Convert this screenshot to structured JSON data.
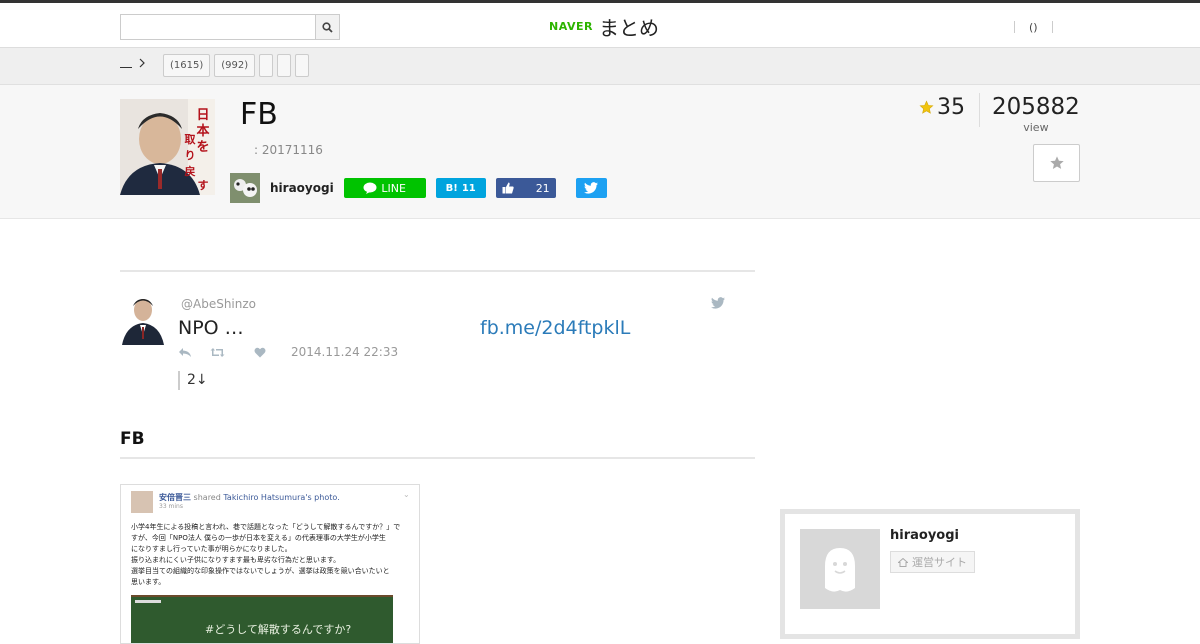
{
  "header": {
    "search": {
      "placeholder": "",
      "value": ""
    },
    "logo": {
      "brand": "NAVER",
      "product": "まとめ"
    },
    "user_nav": {
      "link_label": "()"
    }
  },
  "category_bar": {
    "tags": [
      "(1615)",
      "(992)",
      "",
      "",
      ""
    ]
  },
  "matome": {
    "title": "FB",
    "date": ": 20171116",
    "author": "hiraoyogi",
    "share": {
      "line_label": "LINE",
      "hatena_label": "B!",
      "hatena_count": "11",
      "facebook_count": "21"
    },
    "favorites": "35",
    "views": "205882",
    "views_label": "view"
  },
  "tweet": {
    "handle": "@AbeShinzo",
    "text": "NPO …",
    "link": "fb.me/2d4ftpklL",
    "timestamp": "2014.11.24 22:33",
    "quote": "2↓"
  },
  "section": {
    "heading": "FB"
  },
  "embedded_post": {
    "author": "安倍晋三",
    "shared_text": "shared",
    "source": "Takichiro Hatsumura's photo.",
    "time": "33 mins",
    "lines": [
      "小学4年生による投稿と言われ、巷で話題となった「どうして解散するんですか？」で",
      "すが、今回「NPO法人 僕らの一歩が日本を変える」の代表理事の大学生が小学生",
      "になりすまし行っていた事が明らかになりました。",
      "振り込まれにくい子供になりすます最も卑劣な行為だと思います。",
      "選挙目当ての組織的な印象操作ではないでしょうが、選挙は政策を競い合いたいと",
      "思います。"
    ],
    "chalkboard": "#どうして解散するんですか?"
  },
  "sidebar": {
    "name": "hiraoyogi",
    "site_label": "運営サイト"
  },
  "colors": {
    "accent_green": "#2db400",
    "line": "#00c300",
    "hatena": "#00a4de",
    "facebook": "#3b5998",
    "twitter": "#1da1f2",
    "link": "#2b7bb9"
  }
}
